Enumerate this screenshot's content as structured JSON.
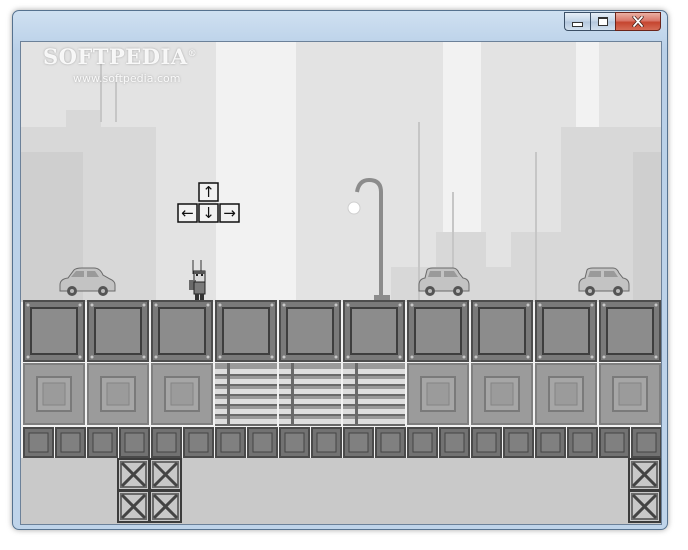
{
  "window": {
    "title": "",
    "caption_buttons": {
      "minimize_icon": "minimize-icon",
      "maximize_icon": "maximize-icon",
      "close_icon": "close-icon"
    }
  },
  "watermark": {
    "brand": "SOFTPEDIA",
    "trademark": "®",
    "url": "www.softpedia.com"
  },
  "game": {
    "hint_keys": [
      "↑",
      "←",
      "↓",
      "→"
    ],
    "colors": {
      "sky": "#f2f2f2",
      "building_far": "#e4e4e4",
      "building_near": "#d2d2d2",
      "crate_fill": "#c8c8c8",
      "platform_dark": "#4a4a4a",
      "platform_mid": "#8a8a8a"
    }
  }
}
